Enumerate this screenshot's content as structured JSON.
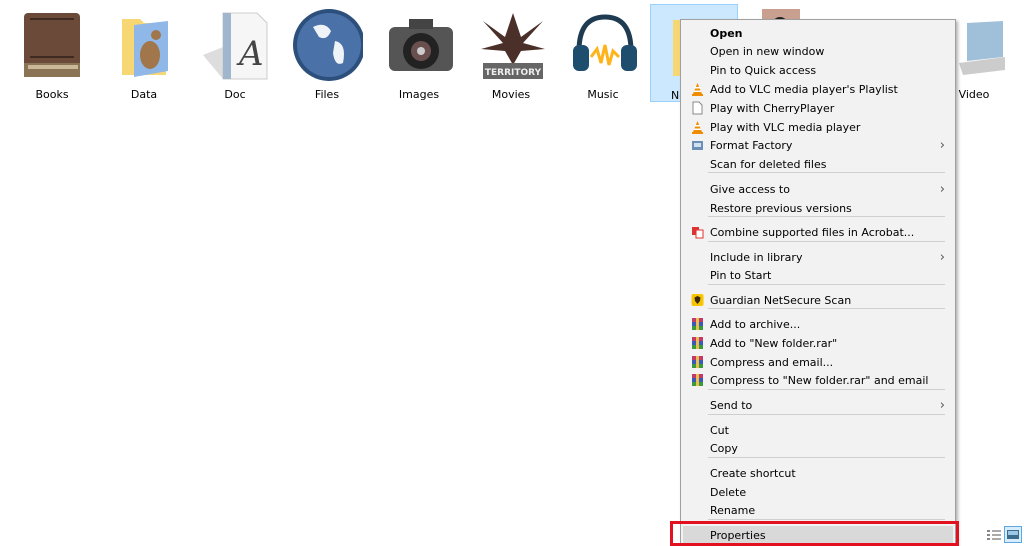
{
  "desktop": {
    "items": [
      {
        "label": "Books",
        "icon": "old-book-icon"
      },
      {
        "label": "Data",
        "icon": "folder-kangaroo-icon"
      },
      {
        "label": "Doc",
        "icon": "document-font-icon"
      },
      {
        "label": "Files",
        "icon": "globe-icon"
      },
      {
        "label": "Images",
        "icon": "camera-icon"
      },
      {
        "label": "Movies",
        "icon": "enemy-territory-icon"
      },
      {
        "label": "Music",
        "icon": "headphones-icon"
      },
      {
        "label": "New folder",
        "icon": "folder-icon",
        "selected": true
      },
      {
        "label": "",
        "icon": "photo-folder-icon"
      },
      {
        "label": "Video",
        "icon": "laptop-icon"
      }
    ]
  },
  "context_menu": {
    "items": [
      {
        "label": "Open",
        "bold": true
      },
      {
        "label": "Open in new window"
      },
      {
        "label": "Pin to Quick access"
      },
      {
        "label": "Add to VLC media player's Playlist",
        "icon": "vlc-icon"
      },
      {
        "label": "Play with CherryPlayer",
        "icon": "page-icon"
      },
      {
        "label": "Play with VLC media player",
        "icon": "vlc-icon"
      },
      {
        "label": "Format Factory",
        "icon": "format-factory-icon",
        "submenu": true
      },
      {
        "label": "Scan for deleted files"
      },
      {
        "label": "Give access to",
        "submenu": true
      },
      {
        "label": "Restore previous versions"
      },
      {
        "label": "Combine supported files in Acrobat...",
        "icon": "acrobat-icon"
      },
      {
        "label": "Include in library",
        "submenu": true
      },
      {
        "label": "Pin to Start"
      },
      {
        "label": "Guardian NetSecure Scan",
        "icon": "guardian-shield-icon"
      },
      {
        "label": "Add to archive...",
        "icon": "winrar-icon"
      },
      {
        "label": "Add to \"New folder.rar\"",
        "icon": "winrar-icon"
      },
      {
        "label": "Compress and email...",
        "icon": "winrar-icon"
      },
      {
        "label": "Compress to \"New folder.rar\" and email",
        "icon": "winrar-icon"
      },
      {
        "label": "Send to",
        "submenu": true
      },
      {
        "label": "Cut"
      },
      {
        "label": "Copy"
      },
      {
        "label": "Create shortcut"
      },
      {
        "label": "Delete"
      },
      {
        "label": "Rename"
      },
      {
        "label": "Properties",
        "highlighted": true
      }
    ],
    "chevron": "›",
    "highlight_color": "#e3101f"
  },
  "status_bar": {
    "details_view": "details-view-icon",
    "large_icons_view": "large-icons-view-icon"
  }
}
